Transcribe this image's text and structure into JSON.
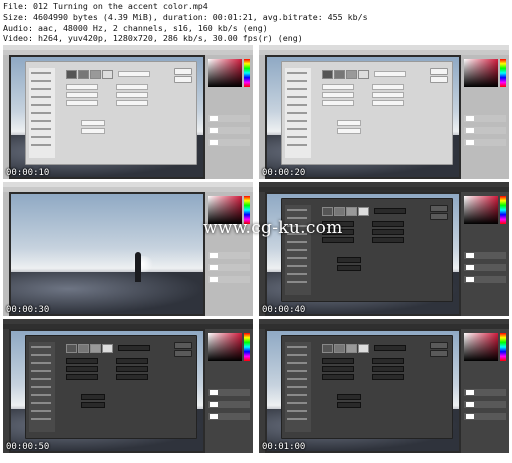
{
  "info": {
    "file": "File: 012 Turning on the accent color.mp4",
    "size": "Size: 4604990 bytes (4.39 MiB), duration: 00:01:21, avg.bitrate: 455 kb/s",
    "audio": "Audio: aac, 48000 Hz, 2 channels, s16, 160 kb/s (eng)",
    "video": "Video: h264, yuv420p, 1280x720, 286 kb/s, 30.00 fps(r) (eng)"
  },
  "watermark": "www.cg-ku.com",
  "thumbnails": [
    {
      "time": "00:00:10",
      "theme": "light",
      "dialog": true
    },
    {
      "time": "00:00:20",
      "theme": "light",
      "dialog": true
    },
    {
      "time": "00:00:30",
      "theme": "light",
      "dialog": false
    },
    {
      "time": "00:00:40",
      "theme": "dark",
      "dialog": true
    },
    {
      "time": "00:00:50",
      "theme": "dark",
      "dialog": true
    },
    {
      "time": "00:01:00",
      "theme": "dark",
      "dialog": true
    }
  ]
}
